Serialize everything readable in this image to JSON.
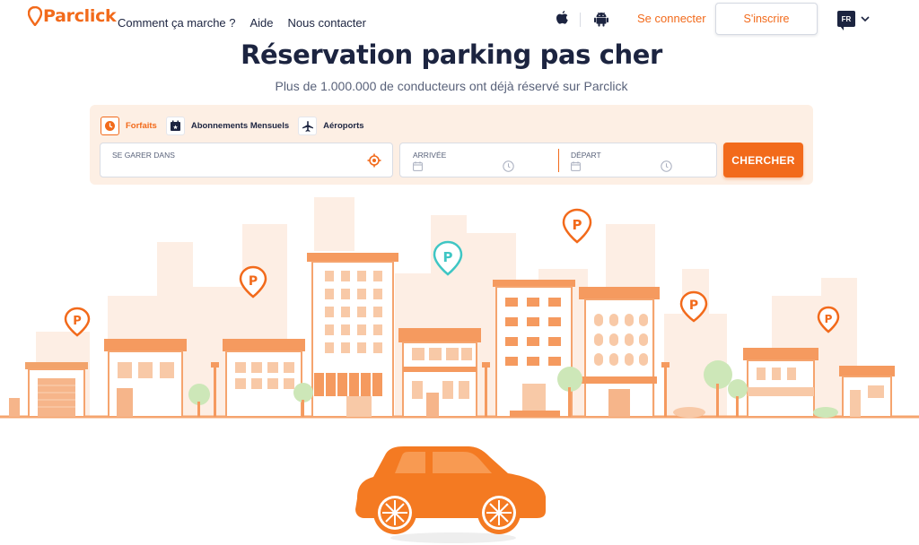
{
  "header": {
    "logo_text": "Parclick",
    "nav": {
      "how_it_works": "Comment ça marche ?",
      "help": "Aide",
      "contact": "Nous contacter"
    },
    "login": "Se connecter",
    "signup": "S'inscrire",
    "language": "FR",
    "icons": [
      "apple-icon",
      "android-icon",
      "chevron-down-icon"
    ]
  },
  "hero": {
    "title": "Réservation parking pas cher",
    "subtitle": "Plus de 1.000.000 de conducteurs ont déjà réservé sur Parclick"
  },
  "search": {
    "tabs": [
      {
        "label": "Forfaits",
        "icon": "clock-icon",
        "active": true
      },
      {
        "label": "Abonnements Mensuels",
        "icon": "calendar-icon",
        "active": false
      },
      {
        "label": "Aéroports",
        "icon": "airplane-icon",
        "active": false
      }
    ],
    "location_label": "SE GARER DANS",
    "arrival_label": "ARRIVÉE",
    "departure_label": "DÉPART",
    "button": "CHERCHER"
  },
  "colors": {
    "brand_orange": "#f26a1b",
    "navy": "#1c2440",
    "teal_pin": "#3fc6c4",
    "panel_bg": "#fdefe4"
  }
}
